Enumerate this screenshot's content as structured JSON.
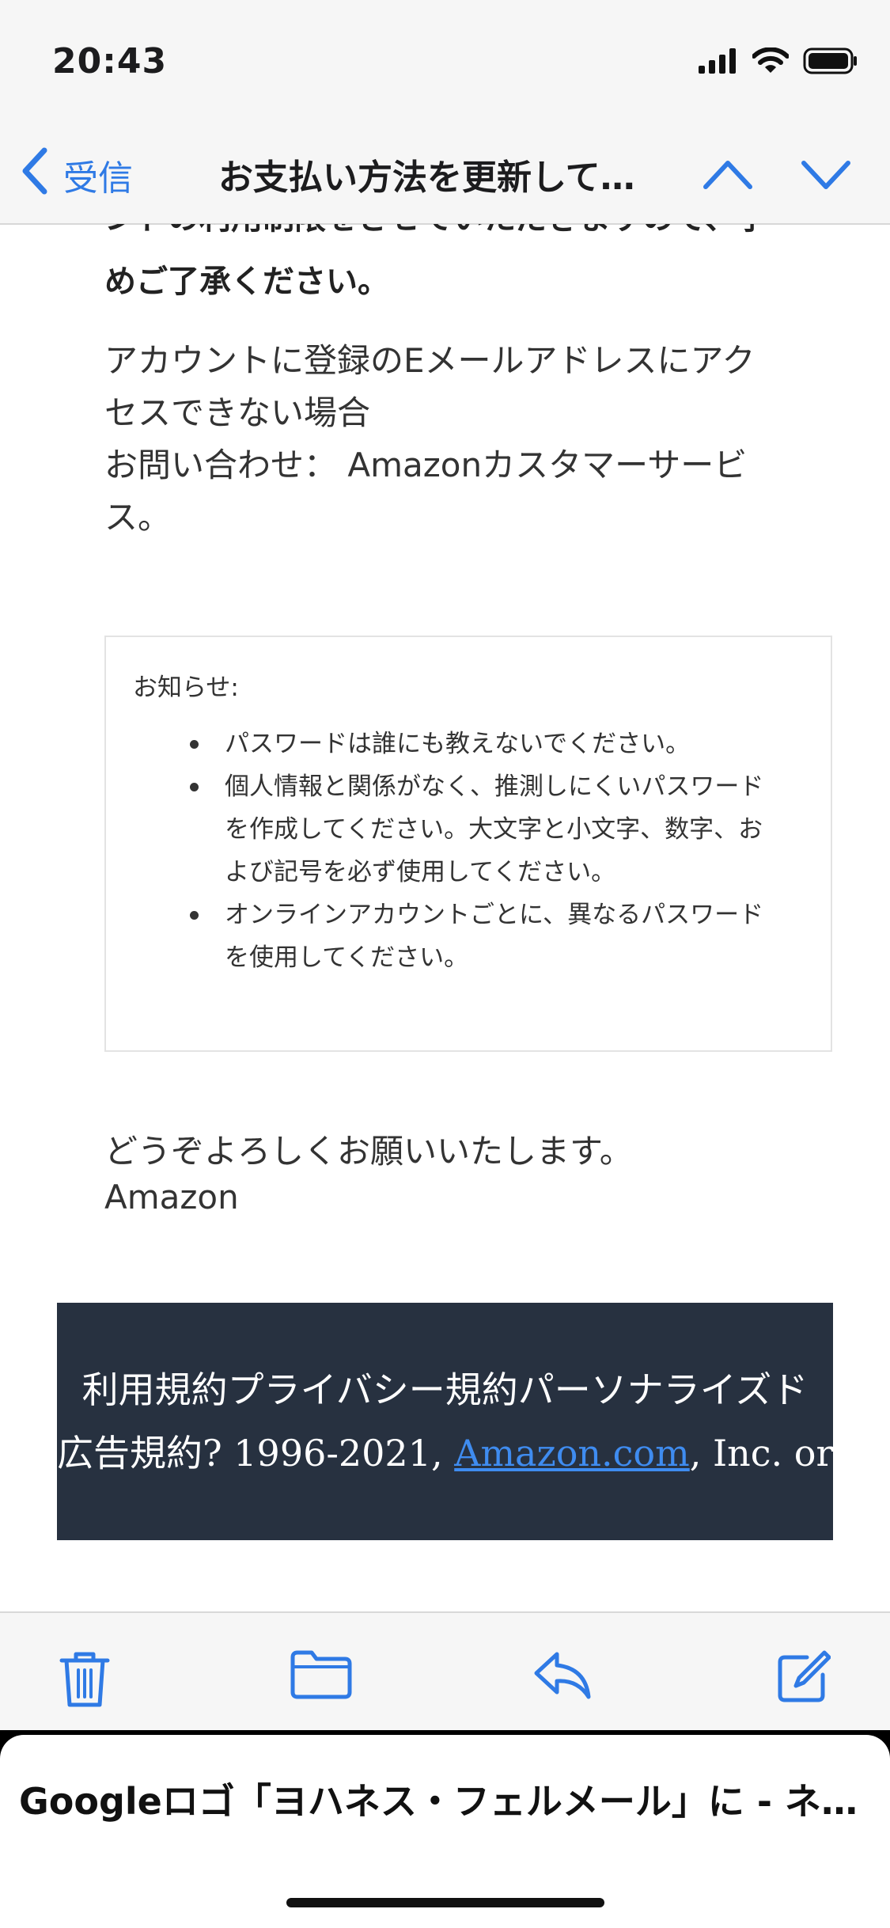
{
  "status_bar": {
    "time": "20:43"
  },
  "nav": {
    "back_label": "受信",
    "title": "お支払い方法を更新して…"
  },
  "email": {
    "cut_line_top": "ンドの利用制限をさせていただきますので、予",
    "cut_line_bottom": "めご了承ください。",
    "paragraph_lines": [
      "アカウントに登録のEメールアドレスにアク",
      "セスできない場合",
      "お問い合わせ： Amazonカスタマーサービ",
      "ス。"
    ],
    "notice": {
      "title": "お知らせ:",
      "items": [
        [
          "パスワードは誰にも教えないでください。"
        ],
        [
          "個人情報と関係がなく、推測しにくいパスワード",
          "を作成してください。大文字と小文字、数字、お",
          "よび記号を必ず使用してください。"
        ],
        [
          "オンラインアカウントごとに、異なるパスワード",
          "を使用してください。"
        ]
      ]
    },
    "closing": "どうぞよろしくお願いいたします。",
    "sender": "Amazon",
    "footer": {
      "line1": "利用規約プライバシー規約パーソナライズド",
      "line2_prefix": "広告規約? 1996-2021, ",
      "line2_link": "Amazon.com",
      "line2_suffix": ", Inc. or its"
    }
  },
  "toolbar": {
    "icons": [
      "trash-icon",
      "folder-icon",
      "reply-icon",
      "compose-icon"
    ]
  },
  "bottom_sheet": {
    "title": "Googleロゴ「ヨハネス・フェルメール」に - ネ…"
  },
  "colors": {
    "accent": "#2f7ae5",
    "footer_bg": "#273140",
    "bar_bg": "#f6f6f6"
  }
}
